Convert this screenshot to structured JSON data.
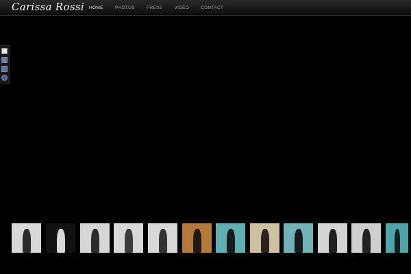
{
  "header": {
    "logo": "Carissa Rossi",
    "nav": [
      {
        "label": "HOME",
        "active": true
      },
      {
        "label": "PHOTOS",
        "active": false
      },
      {
        "label": "PRESS",
        "active": false
      },
      {
        "label": "VIDEO",
        "active": false
      },
      {
        "label": "CONTACT",
        "active": false
      }
    ]
  },
  "social": [
    {
      "icon": "blank-page-icon",
      "color": "#e8e8e8"
    },
    {
      "icon": "myspace-icon",
      "color": "#6b7fa8"
    },
    {
      "icon": "linkedin-icon",
      "color": "#4a78b8"
    },
    {
      "icon": "globe-icon",
      "color": "#3d5fb5"
    }
  ],
  "thumbnails": [
    {
      "bg": "#d8d8d8",
      "figure": "#2a2a2a"
    },
    {
      "bg": "#111111",
      "figure": "#d8d8d8"
    },
    {
      "bg": "#d6d6d6",
      "figure": "#2b2b2b"
    },
    {
      "bg": "#d8d8d8",
      "figure": "#3a3a3a"
    },
    {
      "bg": "#d7d7d7",
      "figure": "#333333"
    },
    {
      "bg": "#b57a3a",
      "figure": "#1f1a18"
    },
    {
      "bg": "#5fb0b3",
      "figure": "#1a1a1a"
    },
    {
      "bg": "#cfc0a0",
      "figure": "#2a2222"
    },
    {
      "bg": "#6fb3b8",
      "figure": "#1a1a1a"
    },
    {
      "bg": "#d4d4d4",
      "figure": "#1e1e1e"
    },
    {
      "bg": "#cfcfcf",
      "figure": "#222222"
    },
    {
      "bg": "#4aa6a8",
      "figure": "#1b1b1b"
    }
  ]
}
